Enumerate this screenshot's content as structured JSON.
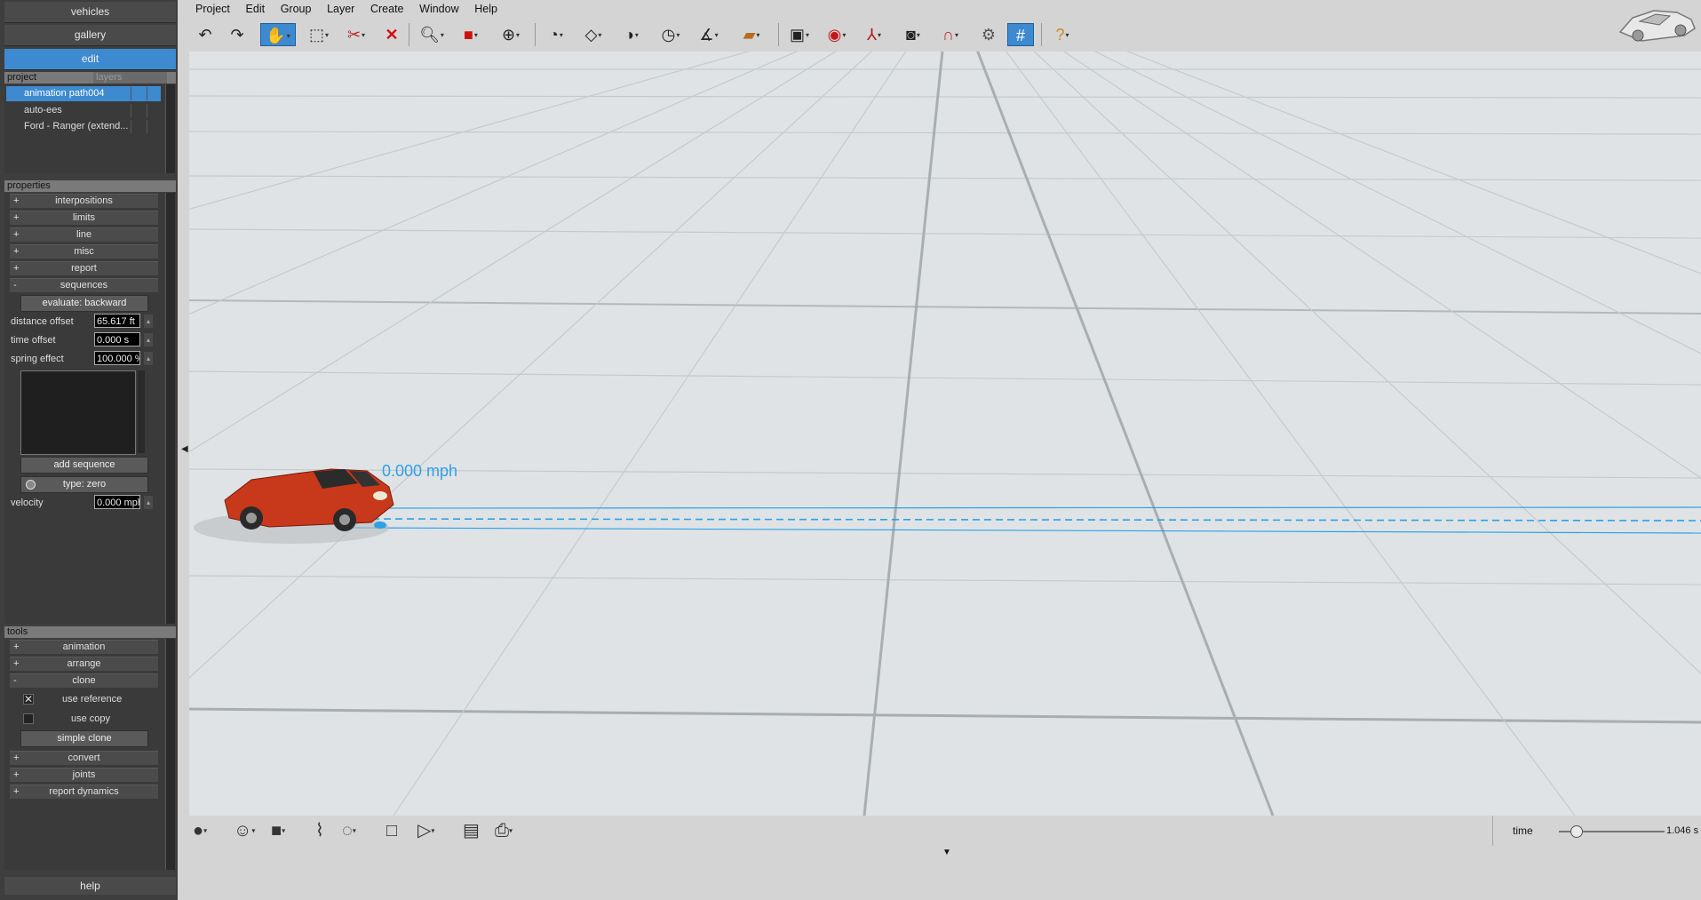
{
  "left_panel": {
    "top_buttons": {
      "vehicles": "vehicles",
      "gallery": "gallery",
      "edit": "edit"
    },
    "project_tab": "project",
    "layers_tab": "layers",
    "project_items": [
      "animation path004",
      "auto-ees",
      "Ford - Ranger (extend..."
    ],
    "properties_title": "properties",
    "properties": [
      {
        "sign": "+",
        "label": "interpositions"
      },
      {
        "sign": "+",
        "label": "limits"
      },
      {
        "sign": "+",
        "label": "line"
      },
      {
        "sign": "+",
        "label": "misc"
      },
      {
        "sign": "+",
        "label": "report"
      },
      {
        "sign": "-",
        "label": "sequences"
      }
    ],
    "evaluate_button": "evaluate: backward",
    "distance_offset": {
      "label": "distance offset",
      "value": "65.617 ft"
    },
    "time_offset": {
      "label": "time offset",
      "value": "0.000 s"
    },
    "spring_effect": {
      "label": "spring effect",
      "value": "100.000 %"
    },
    "add_sequence_button": "add sequence",
    "type_button": "type: zero",
    "velocity": {
      "label": "velocity",
      "value": "0.000 mph"
    },
    "tools_title": "tools",
    "tools_top": [
      {
        "sign": "+",
        "label": "animation"
      },
      {
        "sign": "+",
        "label": "arrange"
      },
      {
        "sign": "-",
        "label": "clone"
      }
    ],
    "use_reference": "use reference",
    "use_copy": "use copy",
    "simple_clone_button": "simple clone",
    "tools_bottom": [
      {
        "sign": "+",
        "label": "convert"
      },
      {
        "sign": "+",
        "label": "joints"
      },
      {
        "sign": "+",
        "label": "report dynamics"
      }
    ],
    "help_button": "help"
  },
  "menubar": [
    "Project",
    "Edit",
    "Group",
    "Layer",
    "Create",
    "Window",
    "Help"
  ],
  "viewport": {
    "speed_label": "0.000 mph",
    "grid_color": "#c3c8cb",
    "path_color": "#2ea0e6",
    "vehicle_color": "#c8381a"
  },
  "timeline": {
    "label": "time",
    "value": "1.046 s",
    "position": 0.16
  },
  "colors": {
    "accent": "#3d8ad0",
    "panel": "#3e3e3e"
  }
}
